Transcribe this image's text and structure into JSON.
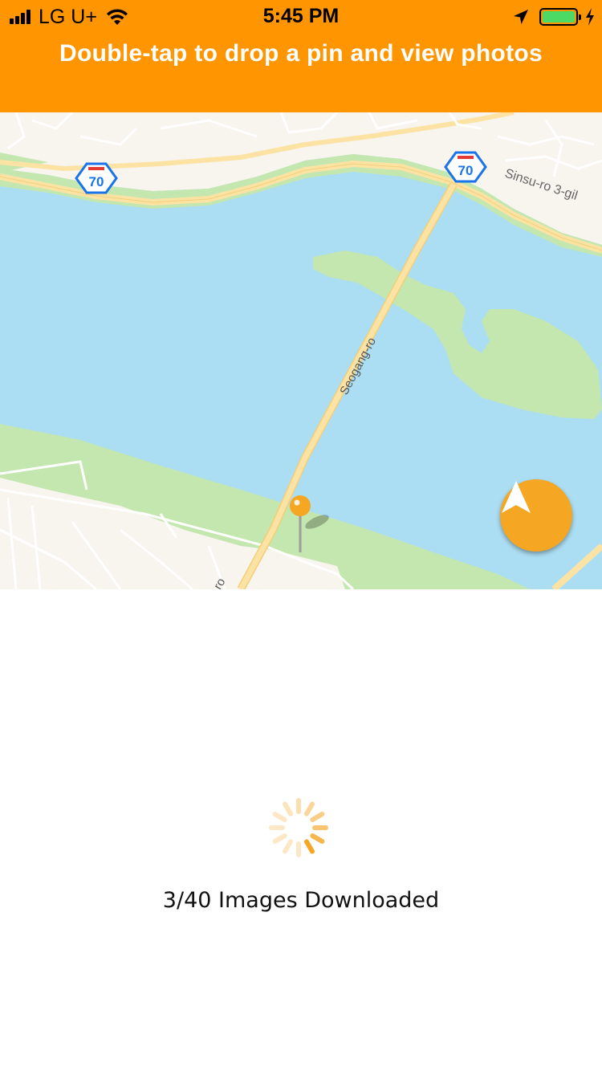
{
  "status_bar": {
    "carrier": "LG U+",
    "time": "5:45 PM",
    "battery_color": "#4CD964"
  },
  "header": {
    "title": "Double-tap to drop a pin and view photos",
    "background": "#FF9500"
  },
  "map": {
    "labels": {
      "bridge_road": "Seogang-ro",
      "street_ne": "Sinsu-ro 3-gil",
      "highway_shield_1": "70",
      "highway_shield_2": "70",
      "road_fragment_sw": "ro"
    },
    "pin_color": "#F5A623",
    "water_color": "#ACDEF3",
    "park_color": "#C3E7AE",
    "land_color": "#F8F4EE"
  },
  "locate_button": {
    "icon": "navigation-arrow-icon",
    "color": "#F5A623"
  },
  "loader": {
    "status_text": "3/40 Images Downloaded"
  }
}
